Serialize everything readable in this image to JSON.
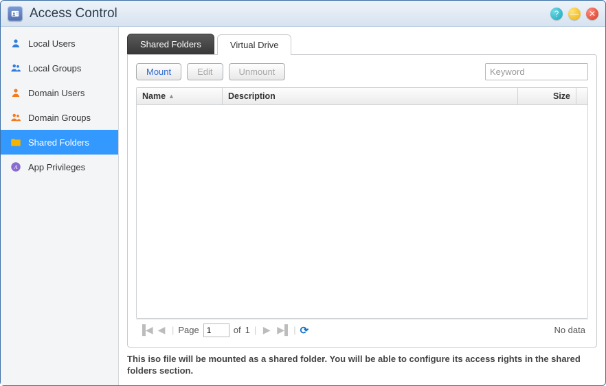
{
  "window": {
    "title": "Access Control"
  },
  "sidebar": {
    "items": [
      {
        "id": "local-users",
        "label": "Local Users",
        "selected": false
      },
      {
        "id": "local-groups",
        "label": "Local Groups",
        "selected": false
      },
      {
        "id": "domain-users",
        "label": "Domain Users",
        "selected": false
      },
      {
        "id": "domain-groups",
        "label": "Domain Groups",
        "selected": false
      },
      {
        "id": "shared-folders",
        "label": "Shared Folders",
        "selected": true
      },
      {
        "id": "app-privileges",
        "label": "App Privileges",
        "selected": false
      }
    ]
  },
  "tabs": {
    "shared_folders": "Shared Folders",
    "virtual_drive": "Virtual Drive",
    "active": "virtual_drive"
  },
  "toolbar": {
    "mount": "Mount",
    "edit": "Edit",
    "unmount": "Unmount"
  },
  "search": {
    "placeholder": "Keyword",
    "value": ""
  },
  "grid": {
    "columns": {
      "name": "Name",
      "description": "Description",
      "size": "Size"
    },
    "sort": {
      "column": "name",
      "direction": "asc"
    },
    "rows": []
  },
  "paging": {
    "page_label": "Page",
    "current_page": "1",
    "of_label": "of",
    "total_pages": "1",
    "status": "No data"
  },
  "footer": {
    "note": "This iso file will be mounted as a shared folder. You will be able to configure its access rights in the shared folders section."
  }
}
